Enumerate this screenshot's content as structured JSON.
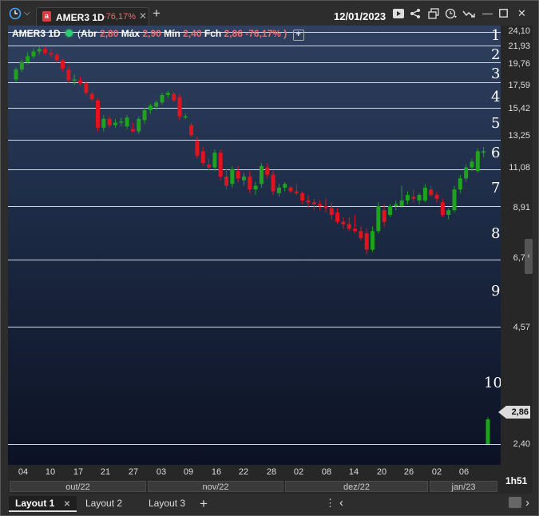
{
  "window": {
    "tab_symbol": "AMER3 1D",
    "tab_change": "-76,17%",
    "tab_logo": "a",
    "date": "12/01/2023"
  },
  "legend": {
    "symbol": "AMER3 1D",
    "open_label": "Abr",
    "open": "2,80",
    "high_label": "Máx",
    "high": "2,90",
    "low_label": "Mín",
    "low": "2,40",
    "close_label": "Fch",
    "close": "2,86",
    "change": "-76,17%",
    "paren_open": "(",
    "paren_close": ")"
  },
  "levels": [
    "1",
    "2",
    "3",
    "4",
    "5",
    "6",
    "7",
    "8",
    "9",
    "10"
  ],
  "y_ticks": [
    "24,10",
    "21,93",
    "19,76",
    "17,59",
    "15,42",
    "13,25",
    "11,08",
    "8,91",
    "6,74",
    "4,57",
    "2,40"
  ],
  "last_price": "2,86",
  "x_ticks": [
    "04",
    "10",
    "17",
    "21",
    "27",
    "03",
    "09",
    "16",
    "22",
    "28",
    "02",
    "08",
    "14",
    "20",
    "26",
    "02",
    "06"
  ],
  "months": [
    "out/22",
    "nov/22",
    "dez/22",
    "jan/23"
  ],
  "time_remaining": "1h51",
  "layout_tabs": [
    "Layout 1",
    "Layout 2",
    "Layout 3"
  ],
  "colors": {
    "up": "#1fa31f",
    "down": "#e0141e",
    "level_line": "#cfd8e8",
    "accent": "#e03a3e"
  },
  "chart_data": {
    "type": "candlestick",
    "y_axis_ticks": [
      24.1,
      21.93,
      19.76,
      17.59,
      15.42,
      13.25,
      11.08,
      8.91,
      6.74,
      4.57,
      2.4
    ],
    "horizontal_levels": [
      24.0,
      22.1,
      20.0,
      17.9,
      15.5,
      13.0,
      11.0,
      9.0,
      6.7,
      4.6,
      2.4
    ],
    "last_price": 2.86,
    "candles": [
      {
        "o": 18.2,
        "h": 19.4,
        "l": 17.9,
        "c": 19.2
      },
      {
        "o": 19.2,
        "h": 20.3,
        "l": 18.9,
        "c": 20.0
      },
      {
        "o": 20.0,
        "h": 21.2,
        "l": 19.7,
        "c": 20.7
      },
      {
        "o": 20.7,
        "h": 21.7,
        "l": 20.4,
        "c": 21.3
      },
      {
        "o": 21.3,
        "h": 21.9,
        "l": 20.9,
        "c": 21.6
      },
      {
        "o": 21.6,
        "h": 21.9,
        "l": 20.9,
        "c": 21.1
      },
      {
        "o": 21.1,
        "h": 21.6,
        "l": 20.6,
        "c": 20.9
      },
      {
        "o": 20.9,
        "h": 21.2,
        "l": 19.9,
        "c": 20.2
      },
      {
        "o": 20.2,
        "h": 20.4,
        "l": 19.0,
        "c": 19.3
      },
      {
        "o": 19.2,
        "h": 19.5,
        "l": 17.8,
        "c": 18.1
      },
      {
        "o": 18.1,
        "h": 18.7,
        "l": 17.6,
        "c": 18.2
      },
      {
        "o": 18.1,
        "h": 18.5,
        "l": 17.6,
        "c": 17.8
      },
      {
        "o": 17.8,
        "h": 18.0,
        "l": 16.7,
        "c": 16.9
      },
      {
        "o": 16.8,
        "h": 17.0,
        "l": 16.1,
        "c": 16.3
      },
      {
        "o": 16.2,
        "h": 16.4,
        "l": 13.6,
        "c": 13.9
      },
      {
        "o": 13.9,
        "h": 14.9,
        "l": 13.6,
        "c": 14.6
      },
      {
        "o": 14.6,
        "h": 14.9,
        "l": 13.9,
        "c": 14.1
      },
      {
        "o": 14.1,
        "h": 14.6,
        "l": 13.9,
        "c": 14.3
      },
      {
        "o": 14.3,
        "h": 14.7,
        "l": 14.0,
        "c": 14.4
      },
      {
        "o": 14.0,
        "h": 14.9,
        "l": 13.8,
        "c": 14.7
      },
      {
        "o": 13.8,
        "h": 14.3,
        "l": 13.5,
        "c": 13.6
      },
      {
        "o": 13.6,
        "h": 14.8,
        "l": 13.4,
        "c": 14.6
      },
      {
        "o": 14.5,
        "h": 15.5,
        "l": 14.2,
        "c": 15.3
      },
      {
        "o": 15.3,
        "h": 15.9,
        "l": 15.0,
        "c": 15.7
      },
      {
        "o": 15.6,
        "h": 16.2,
        "l": 15.3,
        "c": 16.0
      },
      {
        "o": 16.0,
        "h": 16.9,
        "l": 15.8,
        "c": 16.7
      },
      {
        "o": 16.7,
        "h": 17.1,
        "l": 16.4,
        "c": 16.9
      },
      {
        "o": 16.8,
        "h": 17.0,
        "l": 16.1,
        "c": 16.2
      },
      {
        "o": 16.5,
        "h": 16.8,
        "l": 14.5,
        "c": 14.8
      },
      {
        "o": 14.8,
        "h": 15.0,
        "l": 14.6,
        "c": 14.8
      },
      {
        "o": 14.1,
        "h": 14.3,
        "l": 13.2,
        "c": 13.3
      },
      {
        "o": 12.9,
        "h": 13.2,
        "l": 11.7,
        "c": 11.9
      },
      {
        "o": 12.2,
        "h": 12.5,
        "l": 11.2,
        "c": 11.4
      },
      {
        "o": 11.3,
        "h": 11.7,
        "l": 10.9,
        "c": 11.1
      },
      {
        "o": 11.1,
        "h": 12.3,
        "l": 10.9,
        "c": 12.1
      },
      {
        "o": 12.1,
        "h": 12.3,
        "l": 10.4,
        "c": 10.6
      },
      {
        "o": 10.6,
        "h": 11.0,
        "l": 9.9,
        "c": 10.1
      },
      {
        "o": 10.2,
        "h": 11.2,
        "l": 10.0,
        "c": 11.0
      },
      {
        "o": 10.9,
        "h": 11.2,
        "l": 10.3,
        "c": 10.5
      },
      {
        "o": 10.4,
        "h": 10.8,
        "l": 10.1,
        "c": 10.6
      },
      {
        "o": 10.6,
        "h": 10.9,
        "l": 9.7,
        "c": 9.9
      },
      {
        "o": 9.9,
        "h": 10.3,
        "l": 9.6,
        "c": 10.1
      },
      {
        "o": 10.2,
        "h": 11.4,
        "l": 10.0,
        "c": 11.2
      },
      {
        "o": 11.1,
        "h": 11.4,
        "l": 10.5,
        "c": 10.7
      },
      {
        "o": 10.7,
        "h": 10.9,
        "l": 9.6,
        "c": 9.8
      },
      {
        "o": 9.7,
        "h": 10.2,
        "l": 9.5,
        "c": 10.0
      },
      {
        "o": 10.0,
        "h": 10.3,
        "l": 9.8,
        "c": 10.2
      },
      {
        "o": 10.0,
        "h": 10.1,
        "l": 9.7,
        "c": 9.8
      },
      {
        "o": 9.8,
        "h": 10.2,
        "l": 9.6,
        "c": 9.7
      },
      {
        "o": 9.7,
        "h": 9.8,
        "l": 9.1,
        "c": 9.3
      },
      {
        "o": 9.3,
        "h": 9.6,
        "l": 8.9,
        "c": 9.2
      },
      {
        "o": 9.2,
        "h": 9.4,
        "l": 8.8,
        "c": 9.1
      },
      {
        "o": 9.1,
        "h": 9.3,
        "l": 8.8,
        "c": 9.0
      },
      {
        "o": 9.0,
        "h": 9.4,
        "l": 8.7,
        "c": 8.9
      },
      {
        "o": 8.9,
        "h": 9.2,
        "l": 8.4,
        "c": 8.6
      },
      {
        "o": 8.7,
        "h": 8.9,
        "l": 8.2,
        "c": 8.3
      },
      {
        "o": 8.3,
        "h": 8.5,
        "l": 8.0,
        "c": 8.2
      },
      {
        "o": 8.2,
        "h": 8.5,
        "l": 7.9,
        "c": 8.0
      },
      {
        "o": 8.0,
        "h": 8.6,
        "l": 7.8,
        "c": 7.9
      },
      {
        "o": 7.9,
        "h": 8.1,
        "l": 7.5,
        "c": 7.6
      },
      {
        "o": 7.8,
        "h": 8.0,
        "l": 6.9,
        "c": 7.1
      },
      {
        "o": 7.1,
        "h": 8.1,
        "l": 7.0,
        "c": 7.9
      },
      {
        "o": 7.9,
        "h": 9.2,
        "l": 7.8,
        "c": 9.0
      },
      {
        "o": 8.8,
        "h": 9.1,
        "l": 8.1,
        "c": 8.3
      },
      {
        "o": 8.6,
        "h": 9.1,
        "l": 8.5,
        "c": 9.0
      },
      {
        "o": 9.0,
        "h": 9.3,
        "l": 8.8,
        "c": 9.1
      },
      {
        "o": 9.0,
        "h": 10.1,
        "l": 8.9,
        "c": 9.3
      },
      {
        "o": 9.3,
        "h": 9.8,
        "l": 9.1,
        "c": 9.6
      },
      {
        "o": 9.5,
        "h": 9.9,
        "l": 9.2,
        "c": 9.4
      },
      {
        "o": 9.3,
        "h": 9.7,
        "l": 9.1,
        "c": 9.6
      },
      {
        "o": 9.3,
        "h": 10.2,
        "l": 9.2,
        "c": 10.0
      },
      {
        "o": 9.9,
        "h": 10.1,
        "l": 9.5,
        "c": 9.6
      },
      {
        "o": 9.6,
        "h": 9.8,
        "l": 9.2,
        "c": 9.4
      },
      {
        "o": 9.2,
        "h": 9.4,
        "l": 8.5,
        "c": 8.6
      },
      {
        "o": 8.6,
        "h": 8.9,
        "l": 8.4,
        "c": 8.8
      },
      {
        "o": 8.8,
        "h": 10.1,
        "l": 8.7,
        "c": 9.9
      },
      {
        "o": 9.9,
        "h": 10.7,
        "l": 9.7,
        "c": 10.5
      },
      {
        "o": 10.5,
        "h": 11.3,
        "l": 10.3,
        "c": 11.1
      },
      {
        "o": 11.1,
        "h": 11.7,
        "l": 10.9,
        "c": 11.5
      },
      {
        "o": 10.9,
        "h": 12.4,
        "l": 10.8,
        "c": 12.2
      },
      {
        "o": 12.1,
        "h": 12.5,
        "l": 11.8,
        "c": 12.2
      },
      {
        "o": 2.4,
        "h": 2.9,
        "l": 2.4,
        "c": 2.86
      }
    ]
  }
}
